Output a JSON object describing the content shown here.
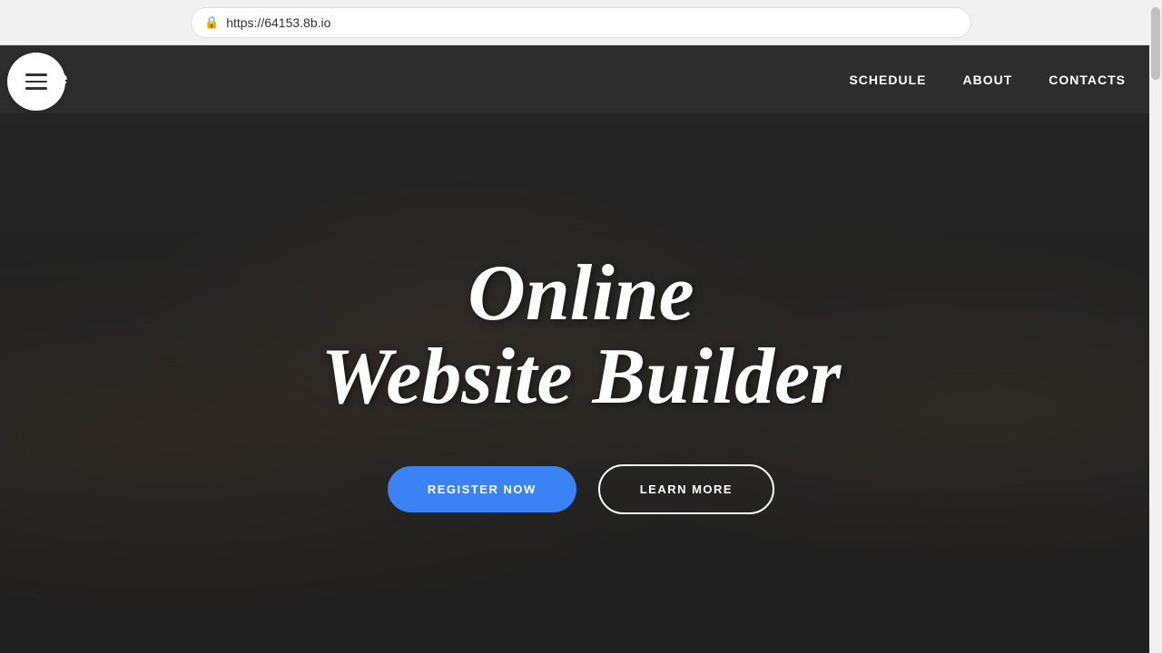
{
  "browser": {
    "url": "https://64153.8b.io",
    "lock_icon": "🔒"
  },
  "navbar": {
    "brand": "site",
    "menu": [
      {
        "label": "SCHEDULE",
        "id": "schedule"
      },
      {
        "label": "ABOUT",
        "id": "about"
      },
      {
        "label": "CONTACTS",
        "id": "contacts"
      }
    ]
  },
  "hero": {
    "title_line1": "Online",
    "title_line2": "Website Builder",
    "register_button": "REGISTER NOW",
    "learn_button": "LEARN MORE"
  },
  "mobile_menu": {
    "aria_label": "Menu"
  }
}
